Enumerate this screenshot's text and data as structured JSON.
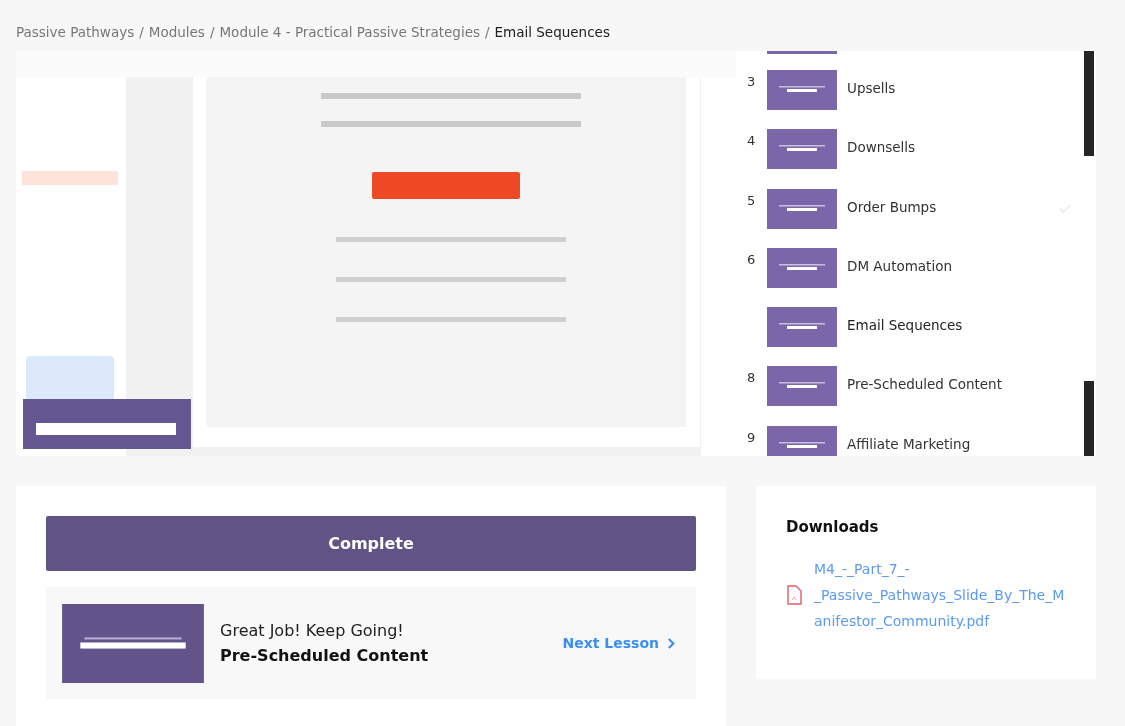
{
  "breadcrumb": {
    "separator": "/",
    "items": [
      {
        "label": "Passive Pathways",
        "current": false
      },
      {
        "label": "Modules",
        "current": false
      },
      {
        "label": "Module 4 - Practical Passive Strategies",
        "current": false
      },
      {
        "label": "Email Sequences",
        "current": true
      }
    ]
  },
  "lessons": [
    {
      "number": "3",
      "title": "Upsells",
      "selected": false,
      "completed": false
    },
    {
      "number": "4",
      "title": "Downsells",
      "selected": false,
      "completed": false
    },
    {
      "number": "5",
      "title": "Order Bumps",
      "selected": false,
      "completed": true
    },
    {
      "number": "6",
      "title": "DM Automation",
      "selected": false,
      "completed": false
    },
    {
      "title": "Email Sequences",
      "selected": true,
      "completed": false
    },
    {
      "number": "8",
      "title": "Pre-Scheduled Content",
      "selected": false,
      "completed": false
    },
    {
      "number": "9",
      "title": "Affiliate Marketing",
      "selected": false,
      "completed": false
    }
  ],
  "complete_button": "Complete",
  "next": {
    "message": "Great Job! Keep Going!",
    "title": "Pre-Scheduled Content",
    "link": "Next Lesson"
  },
  "downloads": {
    "title": "Downloads",
    "files": [
      "M4_-_Part_7_-_Passive_Pathways_Slide_By_The_Manifestor_Community.pdf"
    ]
  }
}
